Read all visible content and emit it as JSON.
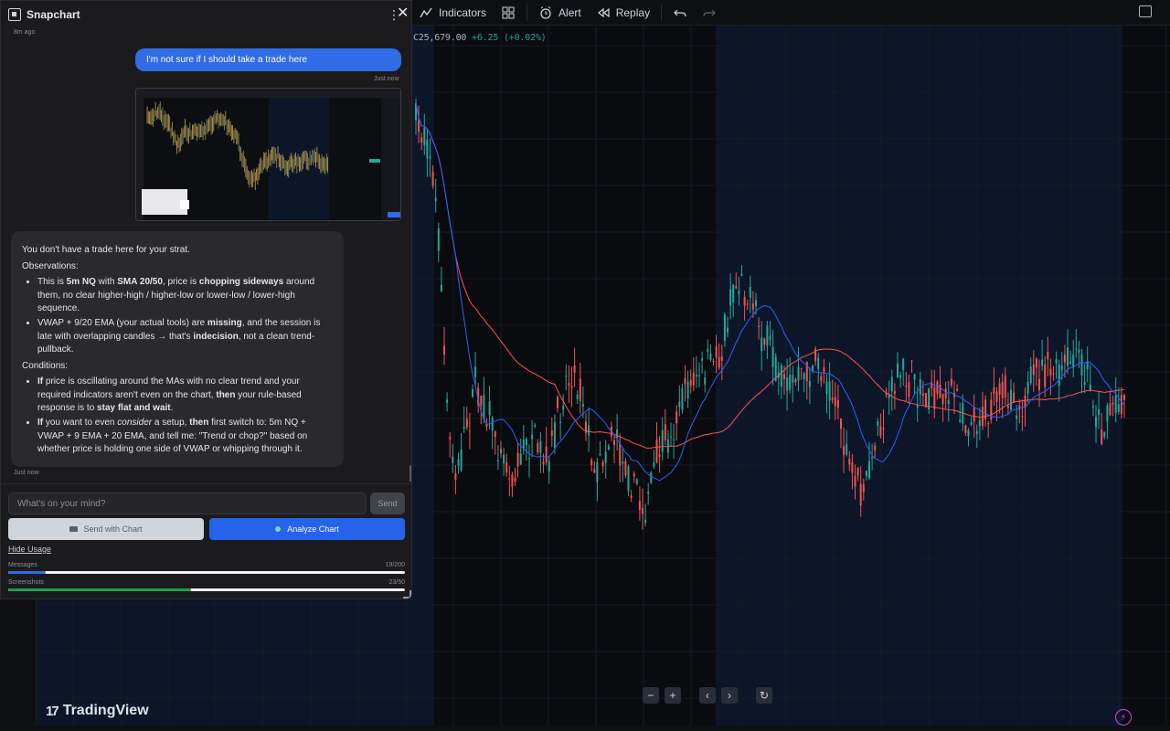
{
  "toolbar": {
    "indicators_label": "Indicators",
    "alert_label": "Alert",
    "replay_label": "Replay"
  },
  "price_readout": {
    "symbol_prefix": "C",
    "price": "25,679.00",
    "change": "+6.25 (+0.02%)"
  },
  "chart_data": {
    "type": "candlestick",
    "indicators": [
      {
        "color": "#ff5252"
      },
      {
        "color": "#2962ff"
      }
    ],
    "colors": {
      "up": "#26a69a",
      "down": "#ef5350",
      "session_shade": "#0c1628"
    }
  },
  "panel": {
    "title": "Snapchart",
    "menu_glyph": "⋮",
    "close_glyph": "✕"
  },
  "messages": {
    "ts_top": "8m ago",
    "user_text": "I'm not sure if I should take a trade here",
    "user_ts": "Just now",
    "ai": {
      "intro": "You don't have a trade here for your strat.",
      "obs_heading": "Observations:",
      "obs1": {
        "a": "This is ",
        "b": "5m NQ",
        "c": " with ",
        "d": "SMA 20/50",
        "e": ", price is ",
        "f": "chopping sideways",
        "g": " around them, no clear higher-high / higher-low or lower-low / lower-high sequence."
      },
      "obs2": {
        "a": "VWAP + 9/20 EMA (your actual tools) are ",
        "b": "missing",
        "c": ", and the session is late with overlapping candles → that's ",
        "d": "indecision",
        "e": ", not a clean trend-pullback."
      },
      "cond_heading": "Conditions:",
      "cond1": {
        "a": "If",
        "b": " price is oscillating around the MAs with no clear trend and your required indicators aren't even on the chart, ",
        "c": "then",
        "d": " your rule-based response is to ",
        "e": "stay flat and wait",
        "f": "."
      },
      "cond2": {
        "a": "If",
        "b": " you want to even ",
        "c": "consider",
        "d": " a setup, ",
        "e": "then",
        "f": " first switch to: 5m NQ + VWAP + 9 EMA + 20 EMA, and tell me: \"Trend or chop?\" based on whether price is holding one side of VWAP or whipping through it."
      }
    },
    "ai_ts": "Just now"
  },
  "composer": {
    "placeholder": "What's on your mind?",
    "send_label": "Send",
    "send_chart_label": "Send with Chart",
    "analyze_label": "Analyze Chart",
    "hide_usage_label": "Hide Usage"
  },
  "usage": {
    "messages_label": "Messages",
    "messages_count": "19/200",
    "messages_fraction": 0.095,
    "screenshots_label": "Screenshots",
    "screenshots_count": "23/50",
    "screenshots_fraction": 0.46
  },
  "chart_controls": {
    "zoom_out": "−",
    "zoom_in": "+",
    "scroll_left": "‹",
    "scroll_right": "›",
    "reset": "↻"
  },
  "brand": {
    "tradingview": "TradingView"
  }
}
